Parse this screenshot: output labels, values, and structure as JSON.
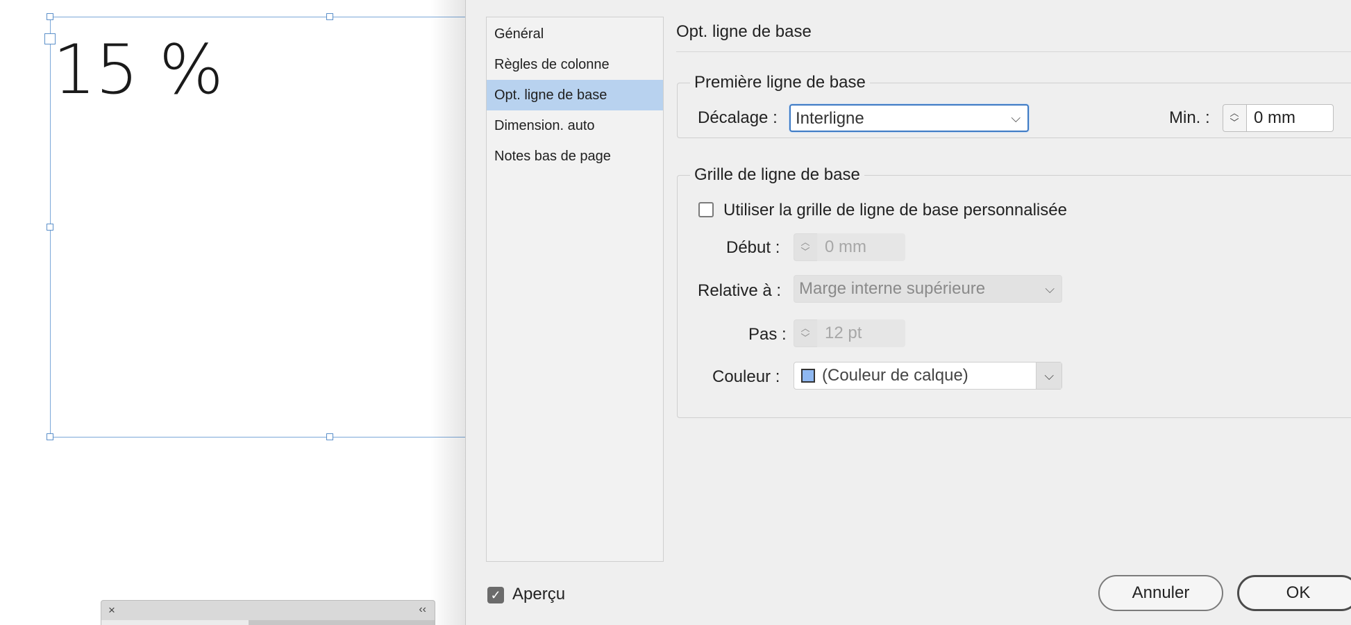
{
  "canvas": {
    "frame_text": "15 %"
  },
  "dialog": {
    "categories": [
      {
        "label": "Général"
      },
      {
        "label": "Règles de colonne"
      },
      {
        "label": "Opt. ligne de base",
        "selected": true
      },
      {
        "label": "Dimension. auto"
      },
      {
        "label": "Notes bas de page"
      }
    ],
    "section_title": "Opt. ligne de base",
    "first_baseline": {
      "legend": "Première ligne de base",
      "offset_label": "Décalage :",
      "offset_value": "Interligne",
      "min_label": "Min. :",
      "min_value": "0 mm"
    },
    "baseline_grid": {
      "legend": "Grille de ligne de base",
      "custom_checkbox_label": "Utiliser la grille de ligne de base personnalisée",
      "custom_checked": false,
      "start_label": "Début :",
      "start_value": "0 mm",
      "relative_label": "Relative à :",
      "relative_value": "Marge interne supérieure",
      "increment_label": "Pas :",
      "increment_value": "12 pt",
      "color_label": "Couleur :",
      "color_value": "(Couleur de calque)",
      "color_swatch": "#8fb8f1"
    },
    "preview_label": "Aperçu",
    "preview_checked": true,
    "cancel_label": "Annuler",
    "ok_label": "OK"
  },
  "icons": {
    "close": "×",
    "collapse": "‹‹",
    "chevron": "⌵",
    "stepper_up": "︿",
    "stepper_down": "﹀",
    "check": "✓"
  },
  "colors": {
    "selection": "#b8d2ef",
    "focus": "#3f7bc4",
    "frame": "#7aa7d8"
  }
}
